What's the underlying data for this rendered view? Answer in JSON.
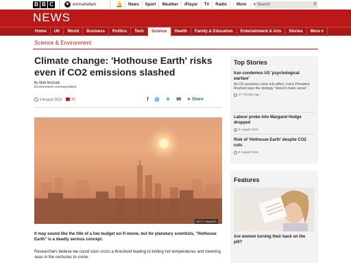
{
  "bbc": {
    "logo_letters": [
      "B",
      "B",
      "C"
    ],
    "username": "emmahallam",
    "topnav": [
      "News",
      "Sport",
      "Weather",
      "iPlayer",
      "TV",
      "Radio",
      "More"
    ],
    "search_placeholder": "Search"
  },
  "news": {
    "wordmark": "NEWS",
    "nav": [
      "Home",
      "UK",
      "World",
      "Business",
      "Politics",
      "Tech",
      "Science",
      "Health",
      "Family & Education",
      "Entertainment & Arts",
      "Stories",
      "More"
    ],
    "active_nav": "Science"
  },
  "section": "Science & Environment",
  "article": {
    "headline": "Climate change: 'Hothouse Earth' risks even if CO2 emissions slashed",
    "author": "By Matt McGrath",
    "role": "Environment correspondent",
    "date": "6 August 2018",
    "comments": "13",
    "share_label": "Share",
    "image_credit": "GETTY IMAGES",
    "lede": "It may sound like the title of a low budget sci-fi movie, but for planetary scientists, \"Hothouse Earth\" is a deadly serious concept.",
    "para2": "Researchers believe we could soon cross a threshold leading to boiling hot temperatures and towering seas in the centuries to come."
  },
  "top_stories": {
    "title": "Top Stories",
    "items": [
      {
        "headline": "Iran condemns US 'psychological warfare'",
        "summary": "As US sanctions come into effect, Iran's President Rouhani says the strategy \"doesn't make sense\".",
        "time": "37 minutes ago"
      },
      {
        "headline": "Labour probe into Margaret Hodge dropped",
        "summary": "",
        "time": "6 August 2018"
      },
      {
        "headline": "Risk of 'Hothouse Earth' despite CO2 cuts",
        "summary": "",
        "time": "6 August 2018"
      }
    ]
  },
  "features": {
    "title": "Features",
    "item": "Are women turning their back on the pill?"
  },
  "colors": {
    "brand_red": "#bb1919",
    "nav_red": "#a91717",
    "sidebar_bg": "#f3f3f3"
  },
  "icons": [
    "user-icon",
    "bell-icon",
    "search-icon",
    "clock-icon",
    "comment-icon",
    "facebook-icon",
    "messenger-icon",
    "twitter-icon",
    "email-icon",
    "share-icon"
  ]
}
